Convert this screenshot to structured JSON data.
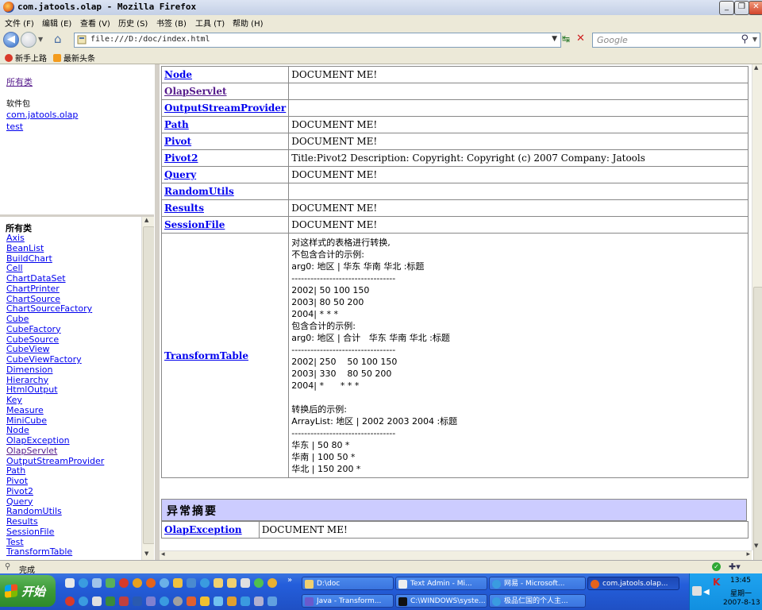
{
  "window": {
    "title": "com.jatools.olap - Mozilla Firefox",
    "buttons": [
      "_",
      "❐",
      "✕"
    ]
  },
  "menu": [
    "文件 (F)",
    "编辑 (E)",
    "查看 (V)",
    "历史 (S)",
    "书签 (B)",
    "工具 (T)",
    "帮助 (H)"
  ],
  "nav": {
    "url": "file:///D:/doc/index.html",
    "search_placeholder": "Google"
  },
  "bookmarks": [
    "新手上路",
    "最新头条"
  ],
  "left_top": {
    "all_classes": "所有类",
    "packages_label": "软件包",
    "packages": [
      "com.jatools.olap",
      "test"
    ]
  },
  "left_bottom": {
    "title": "所有类",
    "classes": [
      "Axis",
      "BeanList",
      "BuildChart",
      "Cell",
      "ChartDataSet",
      "ChartPrinter",
      "ChartSource",
      "ChartSourceFactory",
      "Cube",
      "CubeFactory",
      "CubeSource",
      "CubeView",
      "CubeViewFactory",
      "Dimension",
      "Hierarchy",
      "HtmlOutput",
      "Key",
      "Measure",
      "MiniCube",
      "Node",
      "OlapException",
      "OlapServlet",
      "OutputStreamProvider",
      "Path",
      "Pivot",
      "Pivot2",
      "Query",
      "RandomUtils",
      "Results",
      "SessionFile",
      "Test",
      "TransformTable"
    ]
  },
  "class_summary": [
    {
      "name": "Node",
      "desc": "DOCUMENT ME!"
    },
    {
      "name": "OlapServlet",
      "desc": ""
    },
    {
      "name": "OutputStreamProvider",
      "desc": ""
    },
    {
      "name": "Path",
      "desc": "DOCUMENT ME!"
    },
    {
      "name": "Pivot",
      "desc": "DOCUMENT ME!"
    },
    {
      "name": "Pivot2",
      "desc": "Title:Pivot2 Description: Copyright: Copyright (c) 2007 Company: Jatools"
    },
    {
      "name": "Query",
      "desc": "DOCUMENT ME!"
    },
    {
      "name": "RandomUtils",
      "desc": ""
    },
    {
      "name": "Results",
      "desc": "DOCUMENT ME!"
    },
    {
      "name": "SessionFile",
      "desc": "DOCUMENT ME!"
    }
  ],
  "transform_table": {
    "name": "TransformTable",
    "lines": [
      "对这样式的表格进行转换,",
      "不包含合计的示例:",
      "arg0: 地区 | 华东 华南 华北 :标题",
      "---------------------------------",
      "2002| 50 100 150",
      "2003| 80 50 200",
      "2004| * * *",
      "包含合计的示例:",
      "arg0: 地区 | 合计   华东 华南 华北 :标题",
      "---------------------------------",
      "2002| 250    50 100 150",
      "2003| 330    80 50 200",
      "2004| *      * * *",
      "",
      "转换后的示例:",
      "ArrayList: 地区 | 2002 2003 2004 :标题",
      "---------------------------------",
      "华东 | 50 80 *",
      "华南 | 100 50 *",
      "华北 | 150 200 *"
    ]
  },
  "exception_summary": {
    "header": "异常摘要",
    "rows": [
      {
        "name": "OlapException",
        "desc": "DOCUMENT ME!"
      }
    ]
  },
  "status": {
    "text": "完成"
  },
  "taskbar": {
    "start": "开始",
    "tasks_row1": [
      "D:\\doc",
      "Text Admin - Mi...",
      "网易 - Microsoft...",
      "com.jatools.olap..."
    ],
    "tasks_row2": [
      "Java - Transform...",
      "C:\\WINDOWS\\syste...",
      "极品仁国的个人主..."
    ],
    "clock": {
      "time": "13:45",
      "day": "星期一",
      "date": "2007-8-13"
    }
  }
}
